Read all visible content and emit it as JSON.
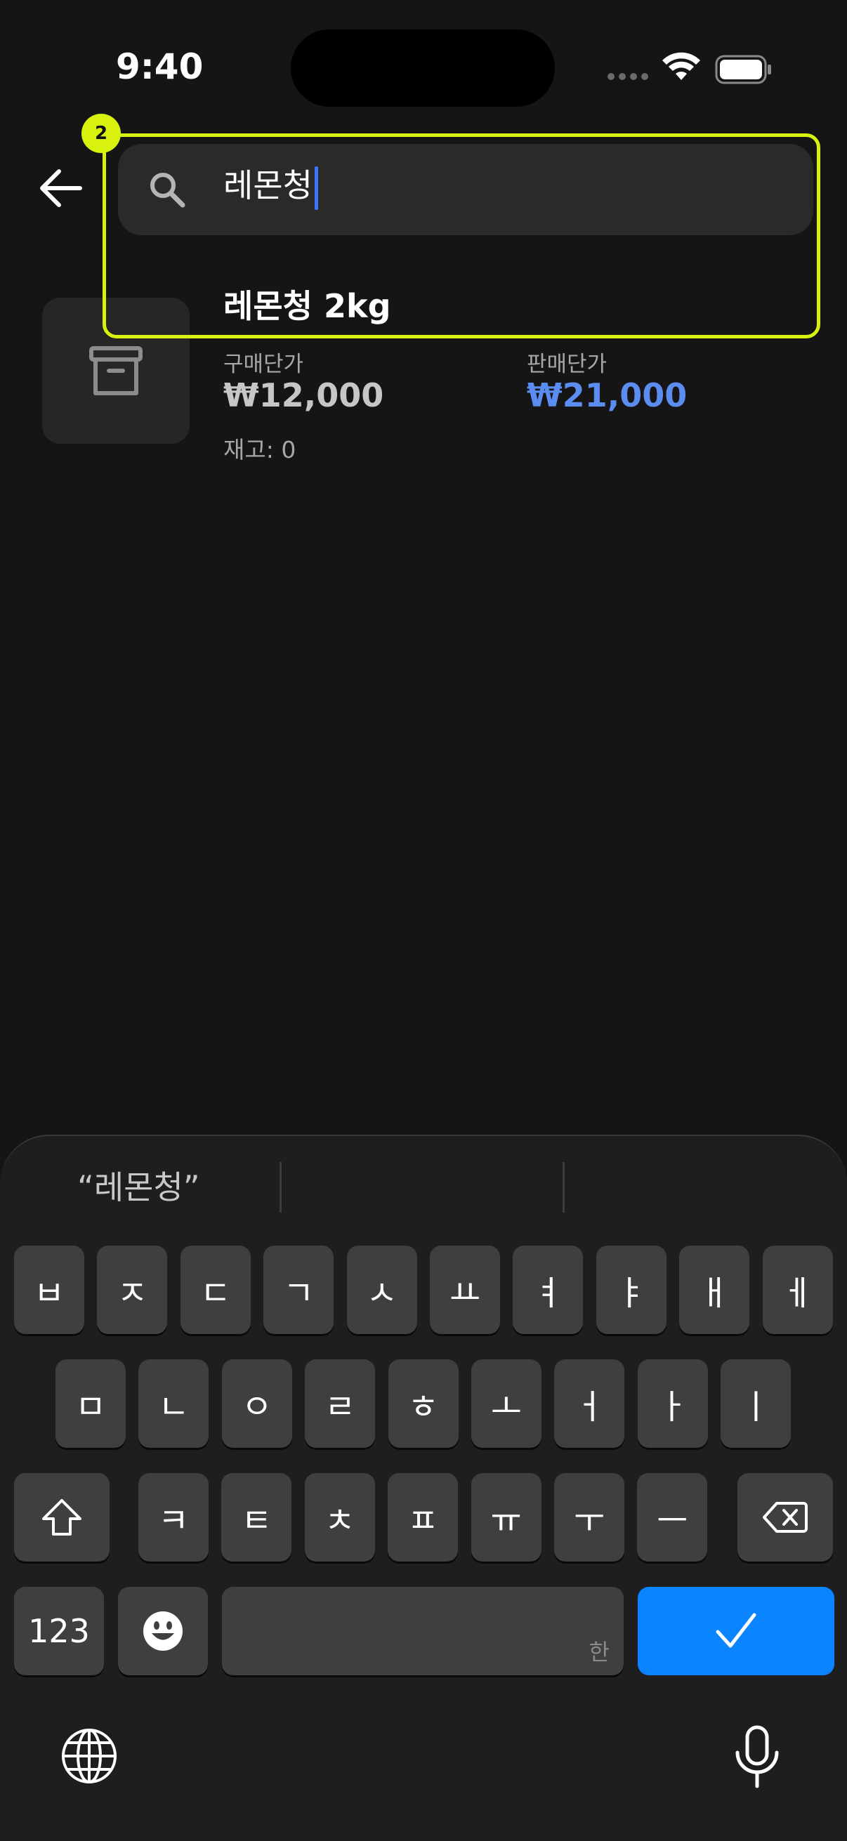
{
  "status_bar": {
    "time": "9:40"
  },
  "search": {
    "value": "레몬청"
  },
  "overlay": {
    "badge": "2",
    "color": "#d8f20e"
  },
  "product": {
    "name": "레몬청 2kg",
    "buy_label": "구매단가",
    "buy_price": "₩12,000",
    "sell_label": "판매단가",
    "sell_price": "₩21,000",
    "stock": "재고: 0"
  },
  "keyboard": {
    "suggestion": "“레몬청”",
    "row1": [
      "ㅂ",
      "ㅈ",
      "ㄷ",
      "ㄱ",
      "ㅅ",
      "ㅛ",
      "ㅕ",
      "ㅑ",
      "ㅐ",
      "ㅔ"
    ],
    "row2": [
      "ㅁ",
      "ㄴ",
      "ㅇ",
      "ㄹ",
      "ㅎ",
      "ㅗ",
      "ㅓ",
      "ㅏ",
      "ㅣ"
    ],
    "row3": [
      "ㅋ",
      "ㅌ",
      "ㅊ",
      "ㅍ",
      "ㅠ",
      "ㅜ",
      "ㅡ"
    ],
    "numbers_label": "123",
    "space_hint": "한",
    "done_color": "#0a84ff"
  },
  "icons": [
    "back-arrow-icon",
    "search-icon",
    "archive-icon",
    "shift-icon",
    "backspace-icon",
    "emoji-icon",
    "checkmark-icon",
    "globe-icon",
    "microphone-icon",
    "wifi-icon",
    "battery-icon"
  ]
}
